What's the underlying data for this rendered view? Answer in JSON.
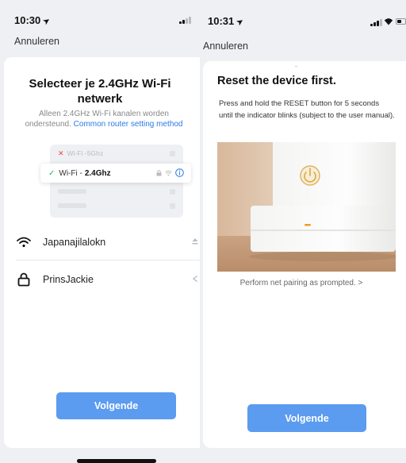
{
  "left": {
    "status_time": "10:30",
    "cancel_label": "Annuleren",
    "title": "Selecteer je 2.4GHz Wi-Fi netwerk",
    "desc_line1": "Alleen 2.4GHz Wi-Fi kanalen worden",
    "desc_line2": "ondersteund.",
    "desc_link": "Common router setting method",
    "illustration": {
      "row_5g_prefix": "Wi-Fi - ",
      "row_5g_band": "5Ghz",
      "row_24_prefix": "Wi-Fi - ",
      "row_24_band": "2.4Ghz"
    },
    "networks": [
      {
        "name": "Japanajilalokn",
        "icon": "wifi-icon"
      },
      {
        "name": "PrinsJackie",
        "icon": "lock-icon"
      }
    ],
    "next_label": "Volgende"
  },
  "right": {
    "status_time": "10:31",
    "cancel_label": "Annuleren",
    "title": "Reset the device first.",
    "desc": "Press and hold the RESET button for 5 seconds until the indicator blinks (subject to the user manual).",
    "prompt": "Perform net pairing as prompted. >",
    "next_label": "Volgende"
  },
  "colors": {
    "accent": "#5b9bf0",
    "link": "#2b7be4",
    "check": "#2bb673",
    "error": "#e44444",
    "background": "#eef0f3",
    "device_led": "#f39a2a"
  }
}
